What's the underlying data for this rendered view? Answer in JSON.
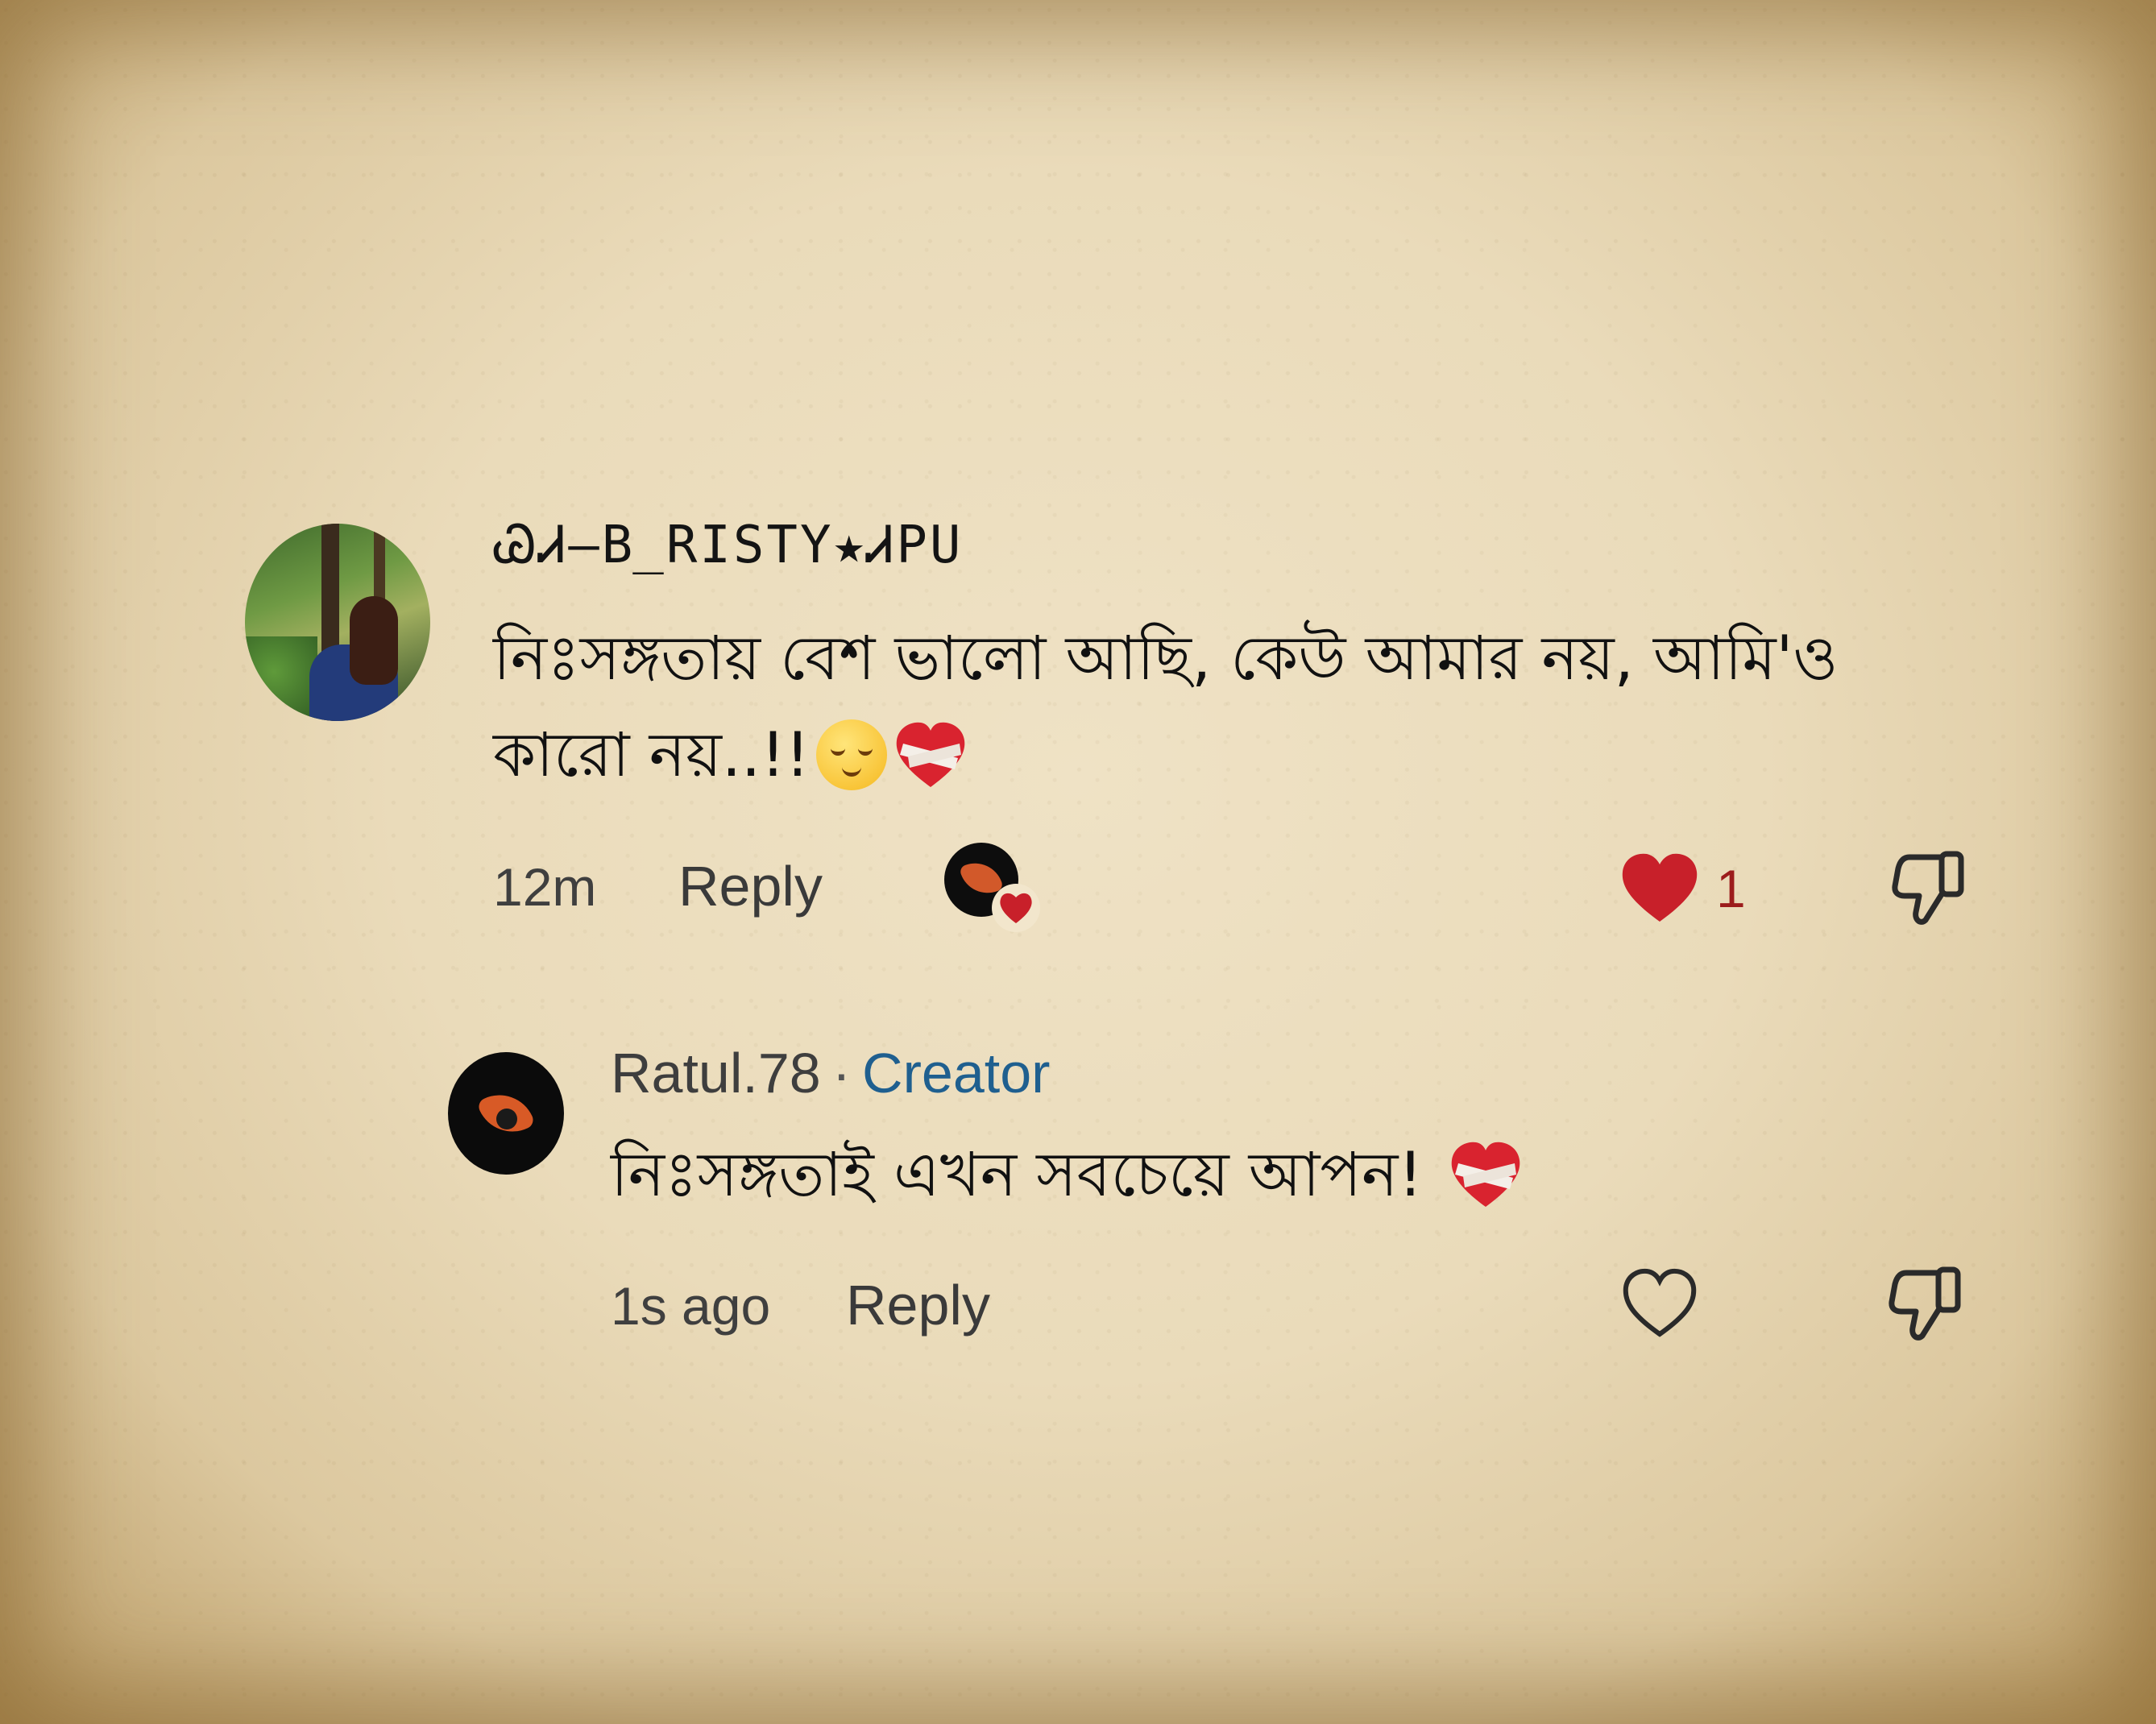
{
  "comment": {
    "username": "ᏊᏗ—B̲RISTY★ᏗPU",
    "text_line1": "নিঃসঙ্গতায় বেশ ভালো আছি, কেউ আমার নয়, আমি'ও",
    "text_line2": "কারো নয়..!!",
    "emojis": [
      "relieved-face",
      "mending-heart"
    ],
    "time": "12m",
    "reply_label": "Reply",
    "creator_liked": true,
    "like_count": "1",
    "liked": true,
    "heart_color": "#c8202a"
  },
  "reply": {
    "username": "Ratul.78",
    "separator": "·",
    "badge": "Creator",
    "badge_color": "#1f5f8f",
    "text": "নিঃসঙ্গতাই এখন সবচেয়ে আপন!",
    "emoji": "mending-heart",
    "time": "1s ago",
    "reply_label": "Reply",
    "liked": false
  }
}
